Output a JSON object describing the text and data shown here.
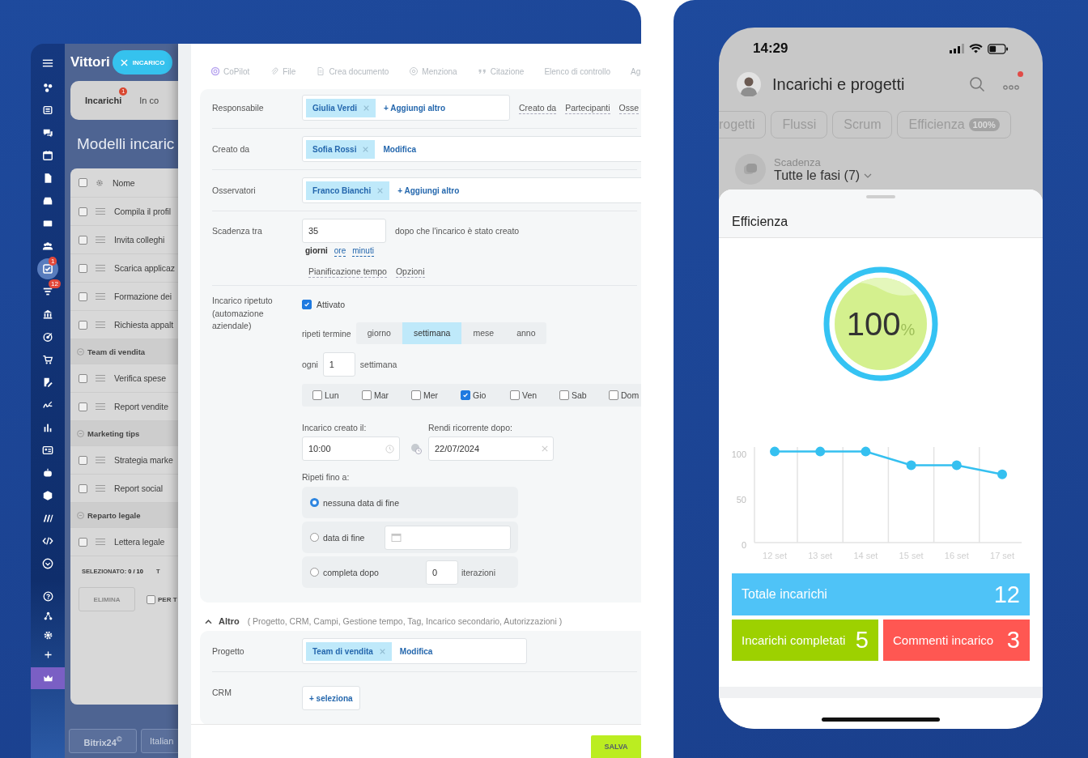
{
  "sidebar": {
    "items": [
      {
        "selected": false
      },
      {
        "selected": false
      },
      {
        "selected": false
      },
      {
        "selected": false
      },
      {
        "selected": false
      },
      {
        "selected": false
      },
      {
        "selected": false
      },
      {
        "selected": false
      },
      {
        "selected": true,
        "badge": "1"
      },
      {
        "selected": false,
        "badge": "12"
      },
      {
        "selected": false
      },
      {
        "selected": false
      },
      {
        "selected": false
      },
      {
        "selected": false
      },
      {
        "selected": false
      },
      {
        "selected": false
      },
      {
        "selected": false
      },
      {
        "selected": false
      },
      {
        "selected": false
      },
      {
        "selected": false
      },
      {
        "selected": false
      },
      {
        "selected": false
      }
    ],
    "bottom_items": [
      {
        "selected": false
      },
      {
        "selected": false
      },
      {
        "selected": false
      },
      {
        "selected": false
      },
      {
        "selected": false
      }
    ]
  },
  "background_page": {
    "title": "Vittori",
    "create_button": "INCARICO",
    "tabs": [
      {
        "label": "Incarichi",
        "badge": "1",
        "selected": true
      },
      {
        "label": "In co",
        "selected": false
      }
    ],
    "heading": "Modelli incaric",
    "table": {
      "header": "Nome",
      "header_checked": false,
      "rows": [
        {
          "kind": "task",
          "name": "Compila il profil",
          "checked": false
        },
        {
          "kind": "task",
          "name": "Invita colleghi",
          "checked": false
        },
        {
          "kind": "task",
          "name": "Scarica applicaz",
          "checked": false
        },
        {
          "kind": "task",
          "name": "Formazione dei",
          "checked": false
        },
        {
          "kind": "task",
          "name": "Richiesta appalt",
          "checked": false
        },
        {
          "kind": "group",
          "name": "Team di vendita"
        },
        {
          "kind": "task",
          "name": "Verifica spese",
          "checked": false
        },
        {
          "kind": "task",
          "name": "Report vendite",
          "checked": false
        },
        {
          "kind": "group",
          "name": "Marketing tips"
        },
        {
          "kind": "task",
          "name": "Strategia marke",
          "checked": false
        },
        {
          "kind": "task",
          "name": "Report social",
          "checked": false
        },
        {
          "kind": "group",
          "name": "Reparto legale"
        },
        {
          "kind": "task",
          "name": "Lettera legale",
          "checked": false
        }
      ]
    },
    "selected_label": "SELEZIONATO:",
    "selected_count": "0 / 10",
    "footer_cut": "T",
    "delete_button": "ELIMINA",
    "apply_all": {
      "label": "PER T",
      "checked": false
    },
    "brand_button": "Bitrix24$^{©}$",
    "language_button": "Italian"
  },
  "form": {
    "toolbar": [
      "CoPilot",
      "File",
      "Crea documento",
      "Menziona",
      "Citazione",
      "Elenco di controllo",
      "Ag"
    ],
    "people_rows": [
      {
        "label": "Responsabile",
        "tags": [
          "Giulia Verdi"
        ],
        "action": "+ Aggiungi altro",
        "links": [
          "Creato da",
          "Partecipanti",
          "Osse"
        ]
      },
      {
        "label": "Creato da",
        "tags": [
          "Sofia Rossi"
        ],
        "action": "Modifica"
      },
      {
        "label": "Osservatori",
        "tags": [
          "Franco Bianchi"
        ],
        "action": "+ Aggiungi altro"
      }
    ],
    "deadline": {
      "label": "Scadenza tra",
      "value": "35",
      "note": "dopo che l'incarico è stato creato",
      "units": [
        {
          "label": "giorni",
          "selected": true
        },
        {
          "label": "ore",
          "selected": false
        },
        {
          "label": "minuti",
          "selected": false
        }
      ],
      "links": [
        "Pianificazione tempo",
        "Opzioni"
      ]
    },
    "repeat": {
      "label": "Incarico ripetuto (automazione aziendale)",
      "enabled": {
        "label": "Attivato",
        "checked": true
      },
      "period_label": "ripeti termine",
      "periods": [
        {
          "label": "giorno",
          "selected": false
        },
        {
          "label": "settimana",
          "selected": true
        },
        {
          "label": "mese",
          "selected": false
        },
        {
          "label": "anno",
          "selected": false
        }
      ],
      "every_label": "ogni",
      "every_value": "1",
      "every_unit": "settimana",
      "days": [
        {
          "label": "Lun",
          "checked": false
        },
        {
          "label": "Mar",
          "checked": false
        },
        {
          "label": "Mer",
          "checked": false
        },
        {
          "label": "Gio",
          "checked": true
        },
        {
          "label": "Ven",
          "checked": false
        },
        {
          "label": "Sab",
          "checked": false
        },
        {
          "label": "Dom",
          "checked": false
        }
      ],
      "created_label": "Incarico creato il:",
      "created_time": "10:00",
      "recurring_label": "Rendi ricorrente dopo:",
      "recurring_date": "22/07/2024",
      "until_label": "Ripeti fino a:",
      "until_options": [
        {
          "kind": "none",
          "label": "nessuna data di fine",
          "selected": true
        },
        {
          "kind": "date",
          "label": "data di fine",
          "selected": false
        },
        {
          "kind": "count",
          "label": "completa dopo",
          "selected": false,
          "value": "0",
          "suffix": "iterazioni"
        }
      ]
    },
    "more": {
      "label": "Altro",
      "items": "( Progetto,  CRM,  Campi,  Gestione tempo,  Tag,  Incarico secondario,  Autorizzazioni )"
    },
    "project_rows": [
      {
        "kind": "tags",
        "label": "Progetto",
        "tags": [
          "Team di vendita"
        ],
        "action": "Modifica"
      },
      {
        "kind": "button",
        "label": "CRM",
        "button": "+ seleziona"
      }
    ],
    "save_button": "SALVA"
  },
  "phone": {
    "time": "14:29",
    "title": "Incarichi e progetti",
    "notification": true,
    "tabs": [
      {
        "label": "rogetti",
        "selected": false
      },
      {
        "label": "Flussi",
        "selected": false
      },
      {
        "label": "Scrum",
        "selected": false
      },
      {
        "label": "Efficienza",
        "badge": "100%",
        "selected": false
      }
    ],
    "filter": {
      "label": "Scadenza",
      "value": "Tutte le fasi (7)"
    },
    "sheet": {
      "title": "Efficienza",
      "gauge": {
        "value": "100",
        "unit": "%"
      },
      "chart_data": {
        "type": "line",
        "categories": [
          "12 set",
          "13 set",
          "14 set",
          "15 set",
          "16 set",
          "17 set"
        ],
        "series": [
          {
            "color": "#35c0f0",
            "marker": "circle",
            "values": [
              100,
              100,
              100,
              85,
              85,
              75
            ]
          }
        ],
        "ylim": [
          0,
          105
        ],
        "yticks": [
          0,
          50,
          100
        ]
      },
      "stats": [
        {
          "label": "Totale incarichi",
          "value": "12",
          "color": "#4fc3f7"
        },
        {
          "label": "Incarichi completati",
          "value": "5",
          "color": "#9dd100"
        },
        {
          "label": "Commenti incarico",
          "value": "3",
          "color": "#ff5752"
        }
      ]
    }
  }
}
